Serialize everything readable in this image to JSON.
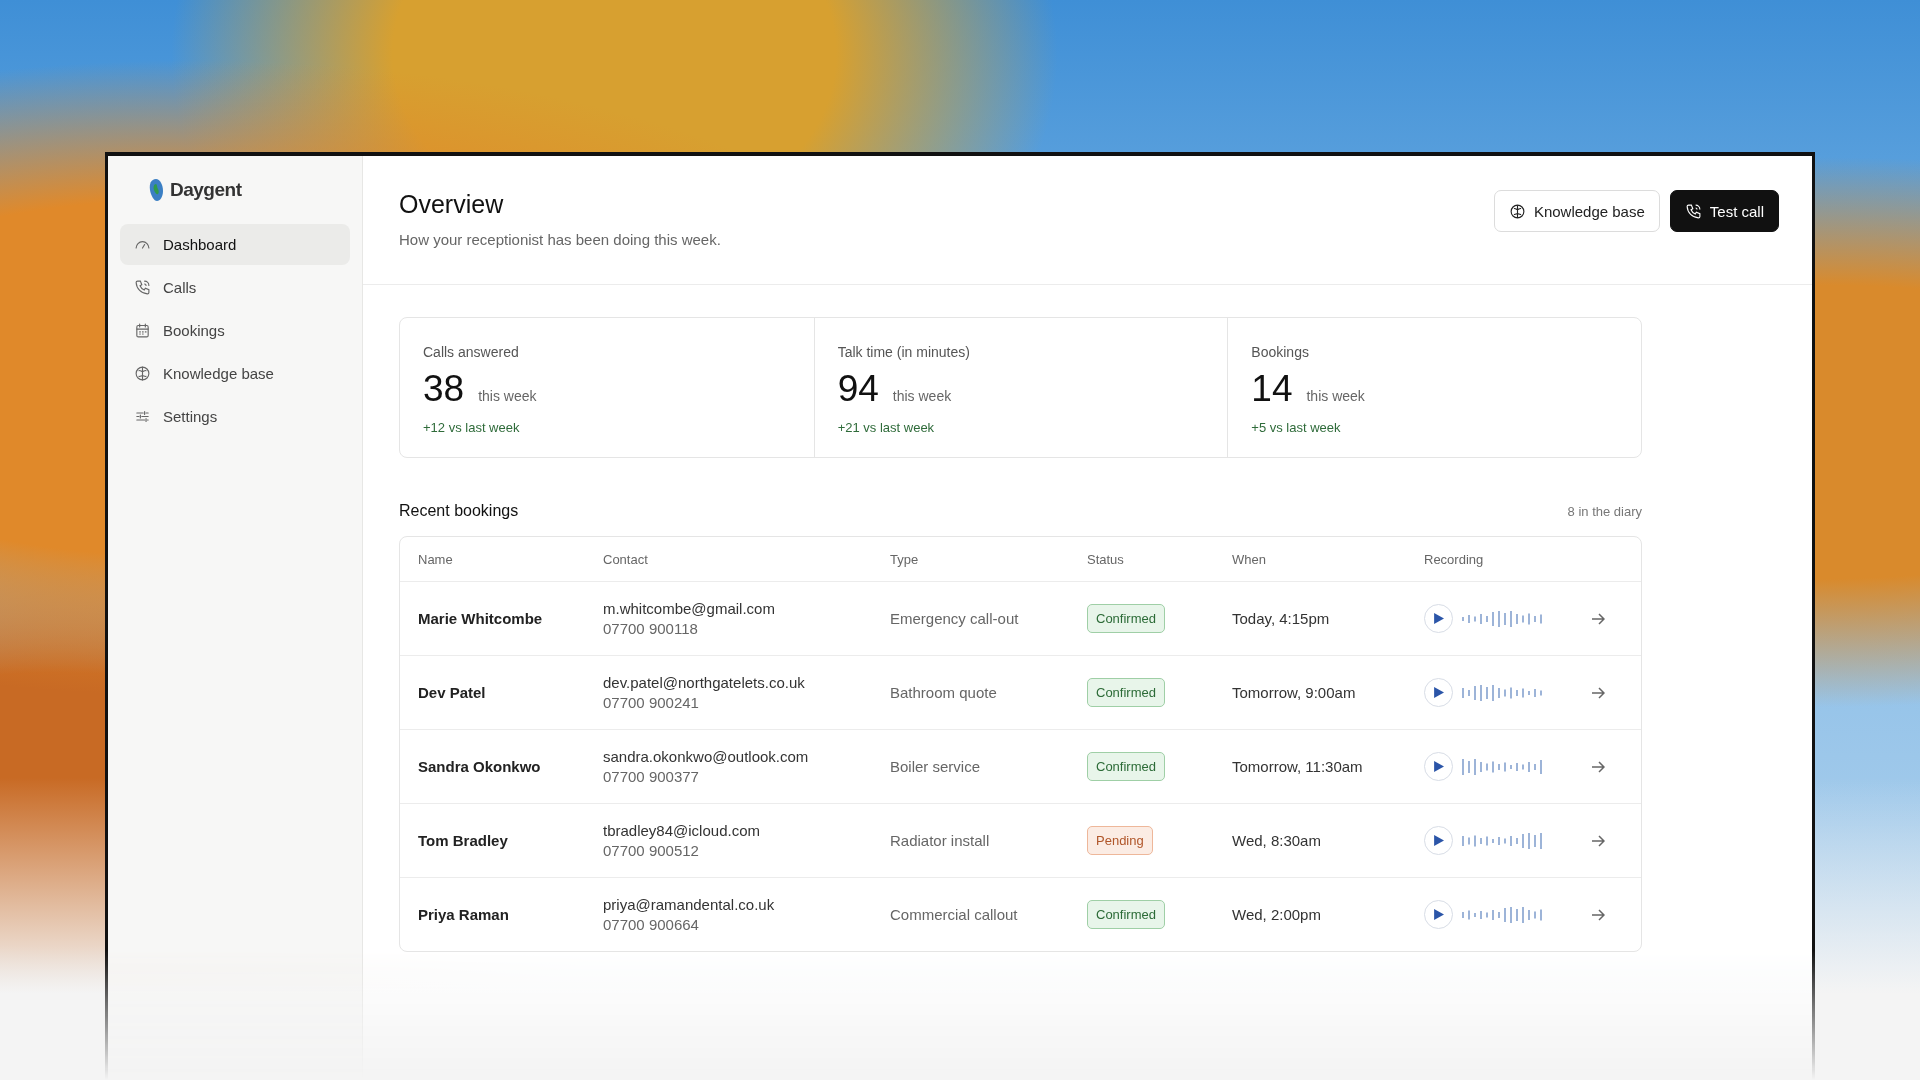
{
  "brand": {
    "name": "Daygent"
  },
  "sidebar": {
    "items": [
      {
        "label": "Dashboard",
        "selected": true
      },
      {
        "label": "Calls",
        "selected": false
      },
      {
        "label": "Bookings",
        "selected": false
      },
      {
        "label": "Knowledge base",
        "selected": false
      },
      {
        "label": "Settings",
        "selected": false
      }
    ]
  },
  "header": {
    "title": "Overview",
    "subtitle": "How your receptionist has been doing this week.",
    "buttons": [
      {
        "label": "Knowledge base",
        "kind": "secondary"
      },
      {
        "label": "Test call",
        "kind": "primary"
      }
    ]
  },
  "stats": [
    {
      "label": "Calls answered",
      "value": "38",
      "unit": "this week",
      "change": "+12 vs last week"
    },
    {
      "label": "Talk time (in minutes)",
      "value": "94",
      "unit": "this week",
      "change": "+21 vs last week"
    },
    {
      "label": "Bookings",
      "value": "14",
      "unit": "this week",
      "change": "+5 vs last week"
    }
  ],
  "recent_bookings": {
    "title": "Recent bookings",
    "count": "8 in the diary",
    "columns": [
      "Name",
      "Contact",
      "Type",
      "Status",
      "When",
      "Recording"
    ],
    "rows": [
      {
        "name": "Marie Whitcombe",
        "email": "m.whitcombe@gmail.com",
        "phone": "07700 900118",
        "type": "Emergency call-out",
        "status": {
          "label": "Confirmed",
          "kind": "confirmed"
        },
        "when": "Today, 4:15pm"
      },
      {
        "name": "Dev Patel",
        "email": "dev.patel@northgatelets.co.uk",
        "phone": "07700 900241",
        "type": "Bathroom quote",
        "status": {
          "label": "Confirmed",
          "kind": "confirmed"
        },
        "when": "Tomorrow, 9:00am"
      },
      {
        "name": "Sandra Okonkwo",
        "email": "sandra.okonkwo@outlook.com",
        "phone": "07700 900377",
        "type": "Boiler service",
        "status": {
          "label": "Confirmed",
          "kind": "confirmed"
        },
        "when": "Tomorrow, 11:30am"
      },
      {
        "name": "Tom Bradley",
        "email": "tbradley84@icloud.com",
        "phone": "07700 900512",
        "type": "Radiator install",
        "status": {
          "label": "Pending",
          "kind": "pending"
        },
        "when": "Wed, 8:30am"
      },
      {
        "name": "Priya Raman",
        "email": "priya@ramandental.co.uk",
        "phone": "07700 900664",
        "type": "Commercial callout",
        "status": {
          "label": "Confirmed",
          "kind": "confirmed"
        },
        "when": "Wed, 2:00pm"
      }
    ]
  }
}
